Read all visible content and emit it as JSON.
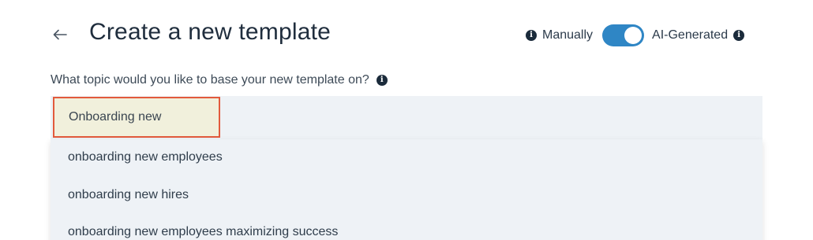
{
  "header": {
    "title": "Create a new template",
    "back_icon": "arrow-left-icon"
  },
  "mode_switch": {
    "manual_label": "Manually",
    "ai_label": "AI-Generated",
    "selected": "AI-Generated",
    "toggle_color": "#2f86c5",
    "info_icon_glyph": "i"
  },
  "question": {
    "label": "What topic would you like to base your new template on?"
  },
  "topic_input": {
    "value": "Onboarding new",
    "highlight_color": "#e25a3c"
  },
  "suggestions": [
    "onboarding new employees",
    "onboarding new hires",
    "onboarding new employees maximizing success"
  ]
}
